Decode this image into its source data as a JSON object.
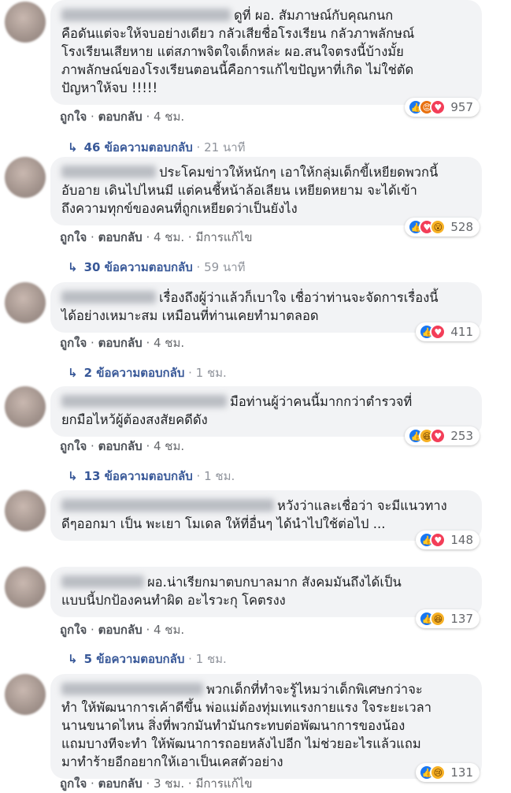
{
  "labels": {
    "like": "ถูกใจ",
    "reply": "ตอบกลับ",
    "edited": "มีการแก้ไข",
    "sep": "·"
  },
  "comments": [
    {
      "name": "Yam Nattha...",
      "text": "ดูที่ ผอ. สัมภาษณ์กับคุณกนก\nคือดันแต่จะให้จบอย่างเดียว กลัวเสียชื่อโรงเรียน กลัวภาพลักษณ์\nโรงเรียนเสียหาย แต่สภาพจิตใจเด็กหล่ะ ผอ.สนใจตรงนี้บ้างมั้ย\nภาพลักษณ์ของโรงเรียนตอนนี้คือการแก้ไขปัญหาที่เกิด ไม่ใช่ตัด\nปัญหาให้จบ !!!!!",
      "reactions": [
        "like",
        "angry",
        "love"
      ],
      "count": "957",
      "time": "4 ชม.",
      "edited": false,
      "reply_count": "46 ข้อความตอบกลับ",
      "reply_time": "21 นาที"
    },
    {
      "name": "วรูณ ...",
      "text": "ประโคมข่าวให้หนักๆ เอาให้กลุ่มเด็กขี้เหยียดพวกนี้\nอับอาย เดินไปไหนมี แต่คนชี้หน้าล้อเลียน เหยียดหยาม จะได้เข้า\nถึงความทุกข์ของคนที่ถูกเหยียดว่าเป็นยังไง",
      "reactions": [
        "like",
        "love",
        "wow"
      ],
      "count": "528",
      "time": "4 ชม.",
      "edited": true,
      "reply_count": "30 ข้อความตอบกลับ",
      "reply_time": "59 นาที"
    },
    {
      "name": "...",
      "text": "เรื่องถึงผู้ว่าแล้วก็เบาใจ เชื่อว่าท่านจะจัดการเรื่องนี้\nได้อย่างเหมาะสม เหมือนที่ท่านเคยทำมาตลอด",
      "reactions": [
        "like",
        "love"
      ],
      "count": "411",
      "time": "4 ชม.",
      "edited": false,
      "reply_count": "2 ข้อความตอบกลับ",
      "reply_time": "1 ชม."
    },
    {
      "name": "...",
      "text": "มือท่านผู้ว่าคนนี้มากกว่าตำรวจที่\nยกมือไหว้ผู้ต้องสงสัยคดีดัง",
      "reactions": [
        "like",
        "haha",
        "love"
      ],
      "count": "253",
      "time": "4 ชม.",
      "edited": false,
      "reply_count": "13 ข้อความตอบกลับ",
      "reply_time": "1 ชม."
    },
    {
      "name": "...",
      "text": "หวังว่าและเชื่อว่า จะมีแนวทาง\nดีๆออกมา เป็น พะเยา โมเดล ให้ที่อื่นๆ ได้นำไปใช้ต่อไป ...",
      "reactions": [
        "like",
        "love"
      ],
      "count": "148",
      "time": "4 ชม.",
      "edited": false,
      "reply_count": "",
      "reply_time": ""
    },
    {
      "name": "...",
      "text": "ผอ.น่าเรียกมาตบกบาลมาก สังคมมันถึงได้เป็น\nแบบนี้ปกป้องคนทำผิด อะไรวะกุ โคตรงง",
      "reactions": [
        "like",
        "haha"
      ],
      "count": "137",
      "time": "4 ชม.",
      "edited": false,
      "reply_count": "5 ข้อความตอบกลับ",
      "reply_time": "1 ชม."
    },
    {
      "name": "...",
      "text": "พวกเด็กที่ทำจะรู้ไหมว่าเด็กพิเศษกว่าจะ\nทำ ให้พัฒนาการเค้าดีขึ้น พ่อแม่ต้องทุ่มเทแรงกายแรง ใจระยะเวลา\nนานขนาดไหน สิ่งที่พวกมันทำมันกระทบต่อพัฒนาการของน้อง\nแถมบางทีจะทำ ให้พัฒนาการถอยหลังไปอีก ไม่ช่วยอะไรแล้วแถม\nมาทำร้ายอีกอยากให้เอาเป็นเคสตัวอย่าง",
      "reactions": [
        "like",
        "sad"
      ],
      "count": "131",
      "time": "3 ชม.",
      "edited": true,
      "reply_count": "",
      "reply_time": ""
    }
  ]
}
